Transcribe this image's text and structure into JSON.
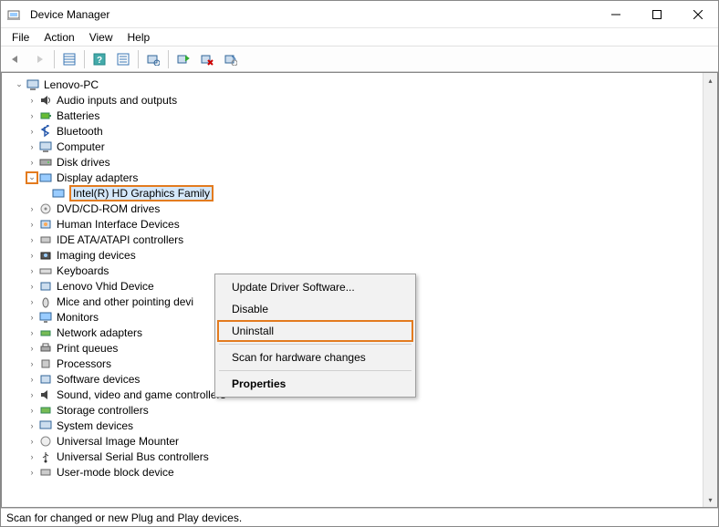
{
  "window": {
    "title": "Device Manager"
  },
  "menu": {
    "file": "File",
    "action": "Action",
    "view": "View",
    "help": "Help"
  },
  "tree": {
    "root": "Lenovo-PC",
    "nodes": [
      "Audio inputs and outputs",
      "Batteries",
      "Bluetooth",
      "Computer",
      "Disk drives",
      "Display adapters",
      "DVD/CD-ROM drives",
      "Human Interface Devices",
      "IDE ATA/ATAPI controllers",
      "Imaging devices",
      "Keyboards",
      "Lenovo Vhid Device",
      "Mice and other pointing devi",
      "Monitors",
      "Network adapters",
      "Print queues",
      "Processors",
      "Software devices",
      "Sound, video and game controllers",
      "Storage controllers",
      "System devices",
      "Universal Image Mounter",
      "Universal Serial Bus controllers",
      "User-mode block device"
    ],
    "display_child": "Intel(R) HD Graphics Family"
  },
  "context_menu": {
    "update": "Update Driver Software...",
    "disable": "Disable",
    "uninstall": "Uninstall",
    "scan": "Scan for hardware changes",
    "properties": "Properties"
  },
  "statusbar": {
    "text": "Scan for changed or new Plug and Play devices."
  },
  "highlight_color": "#e37b1f"
}
